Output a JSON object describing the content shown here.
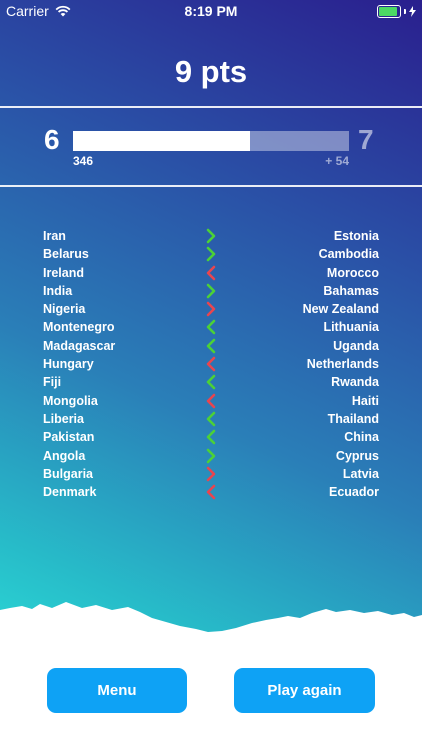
{
  "status_bar": {
    "carrier": "Carrier",
    "time": "8:19 PM"
  },
  "score": {
    "text": "9 pts"
  },
  "level": {
    "current": "6",
    "next": "7",
    "points_value": "346",
    "points_gain": "+ 54",
    "progress": 0.64
  },
  "colors": {
    "correct": "#4cd137",
    "wrong": "#e8454f",
    "button": "#0ea2f5"
  },
  "rows": [
    {
      "left": "Iran",
      "right": "Estonia",
      "direction": "right",
      "correct": true
    },
    {
      "left": "Belarus",
      "right": "Cambodia",
      "direction": "right",
      "correct": true
    },
    {
      "left": "Ireland",
      "right": "Morocco",
      "direction": "left",
      "correct": false
    },
    {
      "left": "India",
      "right": "Bahamas",
      "direction": "right",
      "correct": true
    },
    {
      "left": "Nigeria",
      "right": "New Zealand",
      "direction": "right",
      "correct": false
    },
    {
      "left": "Montenegro",
      "right": "Lithuania",
      "direction": "left",
      "correct": true
    },
    {
      "left": "Madagascar",
      "right": "Uganda",
      "direction": "left",
      "correct": true
    },
    {
      "left": "Hungary",
      "right": "Netherlands",
      "direction": "left",
      "correct": false
    },
    {
      "left": "Fiji",
      "right": "Rwanda",
      "direction": "left",
      "correct": true
    },
    {
      "left": "Mongolia",
      "right": "Haiti",
      "direction": "left",
      "correct": false
    },
    {
      "left": "Liberia",
      "right": "Thailand",
      "direction": "left",
      "correct": true
    },
    {
      "left": "Pakistan",
      "right": "China",
      "direction": "left",
      "correct": true
    },
    {
      "left": "Angola",
      "right": "Cyprus",
      "direction": "right",
      "correct": true
    },
    {
      "left": "Bulgaria",
      "right": "Latvia",
      "direction": "right",
      "correct": false
    },
    {
      "left": "Denmark",
      "right": "Ecuador",
      "direction": "left",
      "correct": false
    }
  ],
  "buttons": {
    "menu": "Menu",
    "play_again": "Play again"
  }
}
